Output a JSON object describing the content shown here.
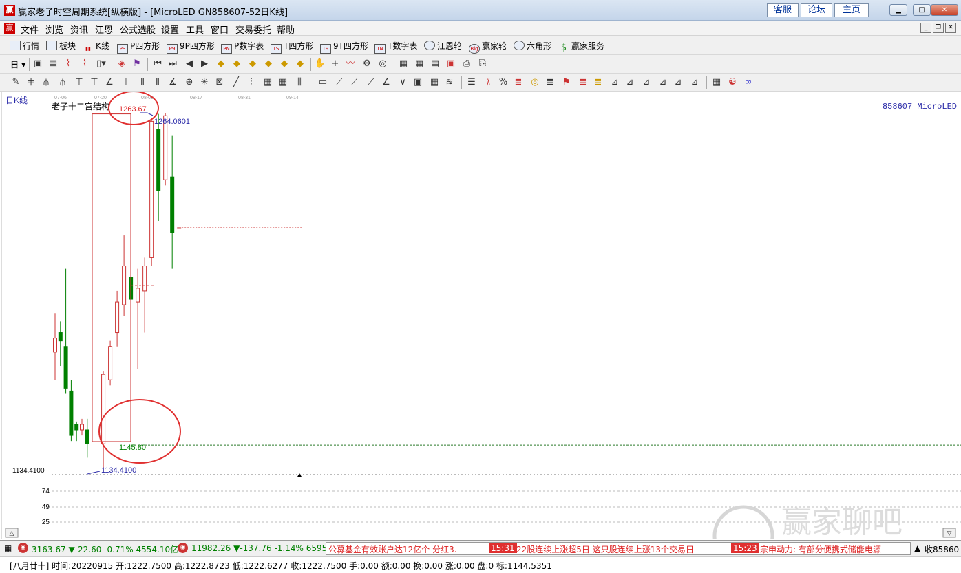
{
  "window": {
    "title": "赢家老子时空周期系统[纵横版] - [MicroLED  GN858607-52日K线]",
    "logo": "赢",
    "links": [
      "客服",
      "论坛",
      "主页"
    ]
  },
  "menu": [
    "文件",
    "浏览",
    "资讯",
    "江恩",
    "公式选股",
    "设置",
    "工具",
    "窗口",
    "交易委托",
    "帮助"
  ],
  "toolbar1": [
    "行情",
    "板块",
    "K线",
    "P四方形",
    "9P四方形",
    "P数字表",
    "T四方形",
    "9T四方形",
    "T数字表",
    "江恩轮",
    "赢家轮",
    "六角形",
    "赢家服务"
  ],
  "toolbar1_icon_tags": [
    "",
    "",
    "",
    "PS",
    "P9",
    "PN",
    "TS",
    "T9",
    "TN",
    "",
    "Big",
    "",
    "$"
  ],
  "toolbar2_first": "日",
  "chart": {
    "period_label": "日K线",
    "indicator_label": "老子十二宫结构",
    "symbol_label": "858607 MicroLED",
    "date_ticks": [
      "07-06",
      "07-20",
      "08-03",
      "08-17",
      "08-31",
      "09-14"
    ],
    "annotation_high": "1263.67",
    "annotation_low": "1145.80",
    "max_label": "1264.0601",
    "min_label": "1134.4100",
    "axis_min_label": "1134.4100",
    "volume_ticks": [
      "74",
      "49",
      "25"
    ],
    "watermark": "赢家聊吧",
    "watermark_url": "liaoba.yjcf360.com"
  },
  "chart_data": {
    "type": "candlestick",
    "title": "老子十二宫结构",
    "x_ticks": [
      "07-06",
      "07-20",
      "08-03",
      "08-17",
      "08-31",
      "09-14"
    ],
    "candles": [
      {
        "open": 1178,
        "close": 1183,
        "high": 1192,
        "low": 1168,
        "dir": "up"
      },
      {
        "open": 1185,
        "close": 1182,
        "high": 1189,
        "low": 1173,
        "dir": "down"
      },
      {
        "open": 1180,
        "close": 1165,
        "high": 1208,
        "low": 1163,
        "dir": "down"
      },
      {
        "open": 1164,
        "close": 1148,
        "high": 1168,
        "low": 1146,
        "dir": "down"
      },
      {
        "open": 1152,
        "close": 1150,
        "high": 1153,
        "low": 1146,
        "dir": "down"
      },
      {
        "open": 1150,
        "close": 1152,
        "high": 1154,
        "low": 1148,
        "dir": "up"
      },
      {
        "open": 1150,
        "close": 1145,
        "high": 1154,
        "low": 1140,
        "dir": "down"
      },
      {
        "open": 1145,
        "close": 1170,
        "high": 1171,
        "low": 1134.41,
        "dir": "up"
      },
      {
        "open": 1168,
        "close": 1180,
        "high": 1182,
        "low": 1166,
        "dir": "up"
      },
      {
        "open": 1185,
        "close": 1196,
        "high": 1200,
        "low": 1180,
        "dir": "up"
      },
      {
        "open": 1195,
        "close": 1209,
        "high": 1220,
        "low": 1191,
        "dir": "up"
      },
      {
        "open": 1205,
        "close": 1197,
        "high": 1214,
        "low": 1190,
        "dir": "down"
      },
      {
        "open": 1196,
        "close": 1201,
        "high": 1208,
        "low": 1172,
        "dir": "up"
      },
      {
        "open": 1200,
        "close": 1209,
        "high": 1212,
        "low": 1185,
        "dir": "up"
      },
      {
        "open": 1212,
        "close": 1261,
        "high": 1262,
        "low": 1209,
        "dir": "up"
      },
      {
        "open": 1258,
        "close": 1236,
        "high": 1263.67,
        "low": 1225,
        "dir": "down"
      },
      {
        "open": 1240,
        "close": 1263,
        "high": 1264.06,
        "low": 1238,
        "dir": "up"
      },
      {
        "open": 1241,
        "close": 1221,
        "high": 1256,
        "low": 1208,
        "dir": "down"
      },
      {
        "open": 1222.75,
        "close": 1222.75,
        "high": 1222.8723,
        "low": 1222.6277,
        "dir": "flat"
      }
    ],
    "high_marker": 1263.67,
    "low_marker": 1145.8,
    "max": 1264.0601,
    "min": 1134.41,
    "price_line": 1222.75,
    "horizontal_line": 1144.5351,
    "ylim": [
      1130,
      1268
    ],
    "colors": {
      "up": "#cc3333",
      "down": "#008000",
      "box": "#cc3333",
      "label_high": "#dd2222",
      "label_low": "#008000",
      "extreme": "#2a2aa8"
    }
  },
  "status": {
    "index1": "3163.67",
    "index1_change": "▼-22.60",
    "index1_pct": "-0.71%",
    "index1_amount": "4554.10亿",
    "index2": "11982.26",
    "index2_change": "▼-137.76",
    "index2_pct": "-1.14%",
    "index2_amount": "6595.5",
    "news1": "公募基金有效账户达12亿个 分红3.",
    "time2": "15:31",
    "news2": "22股连续上涨超5日 这只股连续上涨13个交易日",
    "time3": "15:23",
    "news3": "宗申动力: 有部分便携式储能电源",
    "right": "收85860"
  },
  "info": "[八月廿十] 时间:20220915 开:1222.7500 高:1222.8723 低:1222.6277 收:1222.7500 手:0.00 额:0.00 换:0.00 涨:0.00 盘:0 标:1144.5351"
}
